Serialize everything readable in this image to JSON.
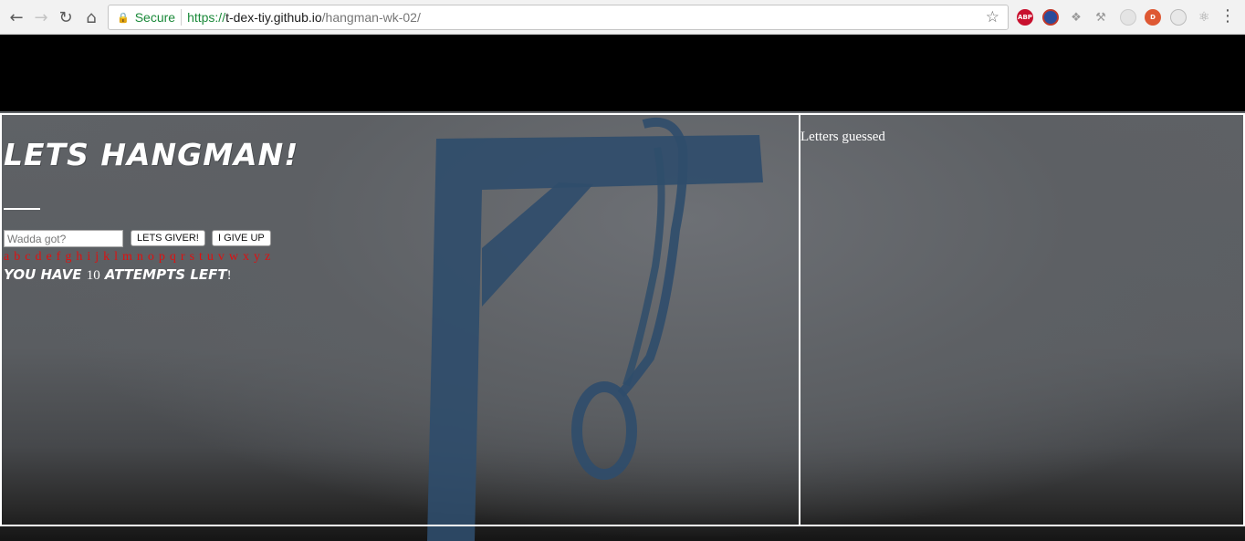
{
  "browser": {
    "secure_label": "Secure",
    "url_scheme": "https://",
    "url_host": "t-dex-tiy.github.io",
    "url_path": "/hangman-wk-02/",
    "extensions": [
      "abp-icon",
      "flag-icon",
      "dropbox-icon",
      "wrench-icon",
      "circle-icon",
      "duckduckgo-icon",
      "gray-circle-icon",
      "react-icon"
    ]
  },
  "game": {
    "title": "Lets hangman!",
    "input_placeholder": "Wadda got?",
    "submit_label": "LETS GIVER!",
    "giveup_label": "I GIVE UP",
    "letters": [
      "a",
      "b",
      "c",
      "d",
      "e",
      "f",
      "g",
      "h",
      "i",
      "j",
      "k",
      "l",
      "m",
      "n",
      "o",
      "p",
      "q",
      "r",
      "s",
      "t",
      "u",
      "v",
      "w",
      "x",
      "y",
      "z"
    ],
    "attempts_prefix": "YOU HAVE ",
    "attempts_count": "10",
    "attempts_suffix": " ATTEMPTS LEFT",
    "attempts_bang": "!",
    "guessed_label": "Letters  guessed"
  },
  "colors": {
    "letters": "#e01010",
    "secure": "#1b8a3a"
  }
}
